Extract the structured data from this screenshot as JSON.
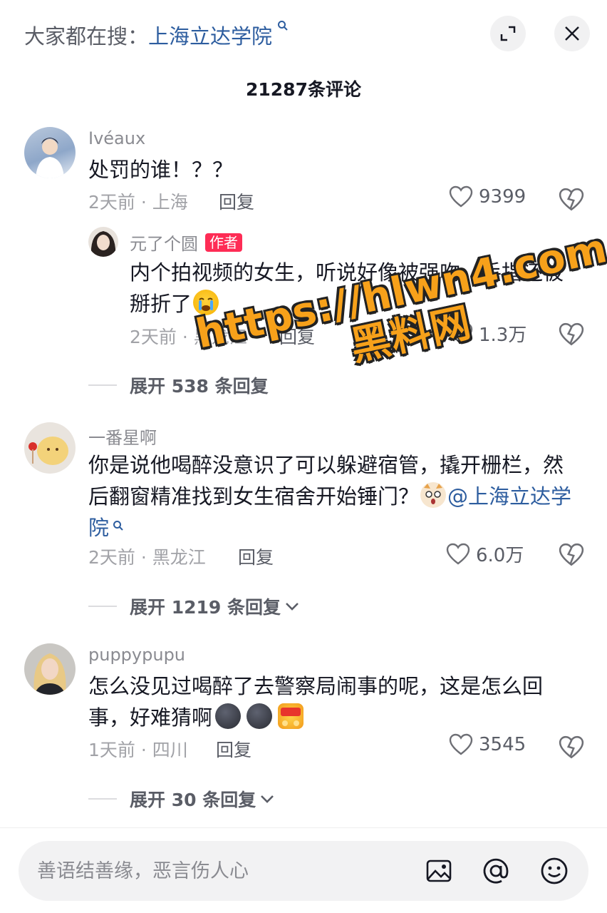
{
  "header": {
    "search_prefix": "大家都在搜：",
    "search_keyword": "上海立达学院",
    "search_suffix_icon": "search-icon",
    "expand_icon": "expand-icon",
    "close_icon": "close-icon"
  },
  "comment_count": "21287条评论",
  "comments": [
    {
      "username": "Ivéaux",
      "text": "处罚的谁！？？",
      "time_location": "2天前 · 上海",
      "reply_label": "回复",
      "likes": "9399"
    },
    {
      "username": "一番星啊",
      "text_a": "你是说他喝醉没意识了可以躲避宿管，撬开栅栏，然后翻窗精准找到女生宿舍开始锤门？",
      "mention": "@上海立达学院",
      "time_location": "2天前 · 黑龙江",
      "reply_label": "回复",
      "likes": "6.0万",
      "expand_label": "展开 1219 条回复"
    },
    {
      "username": "puppypupu",
      "text": "怎么没见过喝醉了去警察局闹事的呢，这是怎么回事，好难猜啊",
      "time_location": "1天前 · 四川",
      "reply_label": "回复",
      "likes": "3545",
      "expand_label": "展开 30 条回复"
    }
  ],
  "sub_reply": {
    "username": "元了个圆",
    "author_tag": "作者",
    "text": "内个拍视频的女生，听说好像被强吻，手指还被掰折了",
    "time_location": "2天前 · 黑龙江",
    "reply_label": "回复",
    "likes": "1.3万",
    "expand_label": "展开 538 条回复"
  },
  "watermark": {
    "line1": "https://hlwn4.com",
    "line2": "黑料网"
  },
  "composer": {
    "placeholder": "善语结善缘，恶言伤人心",
    "image_icon": "image-icon",
    "at_icon": "at-icon",
    "emoji_icon": "emoji-icon"
  },
  "colors": {
    "accent_link": "#2d5d9f",
    "author_tag": "#fe2c55",
    "watermark": "#f7a11a"
  }
}
